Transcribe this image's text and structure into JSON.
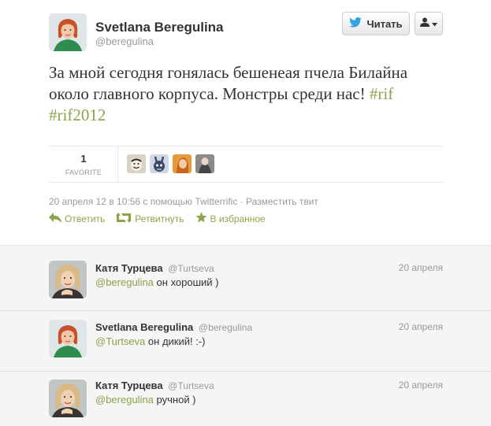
{
  "tweet": {
    "author": {
      "name": "Svetlana Beregulina",
      "handle": "@beregulina"
    },
    "follow_label": "Читать",
    "text_main": "За мной сегодня гонялась бешенеая пчела Билайна около главного корпуса. Монстры среди нас!",
    "hashtags": [
      "#rif",
      "#rif2012"
    ],
    "stats": {
      "favorites_count": "1",
      "favorites_label": "FAVORITE"
    },
    "meta": {
      "timestamp": "20 апреля 12 в 10:56",
      "via_prefix": "с помощью",
      "client": "Twitterrific",
      "separator": "·",
      "embed_label": "Разместить твит"
    },
    "actions": {
      "reply": "Ответить",
      "retweet": "Ретвитнуть",
      "favorite": "В избранное"
    }
  },
  "replies": [
    {
      "name": "Катя Турцева",
      "handle": "@Turtseva",
      "date": "20 апреля",
      "mention": "@beregulina",
      "text": "он хороший )"
    },
    {
      "name": "Svetlana Beregulina",
      "handle": "@beregulina",
      "date": "20 апреля",
      "mention": "@Turtseva",
      "text": "он дикий! :-)"
    },
    {
      "name": "Катя Турцева",
      "handle": "@Turtseva",
      "date": "20 апреля",
      "mention": "@beregulina",
      "text": "ручной )"
    }
  ],
  "icons": {
    "follow": "bird-icon",
    "user": "user-icon",
    "reply": "reply-icon",
    "retweet": "retweet-icon",
    "favorite": "star-icon"
  },
  "colors": {
    "accent": "#8ca449",
    "muted": "#999999",
    "text": "#333333",
    "reply_bg": "#f5f5f5"
  }
}
